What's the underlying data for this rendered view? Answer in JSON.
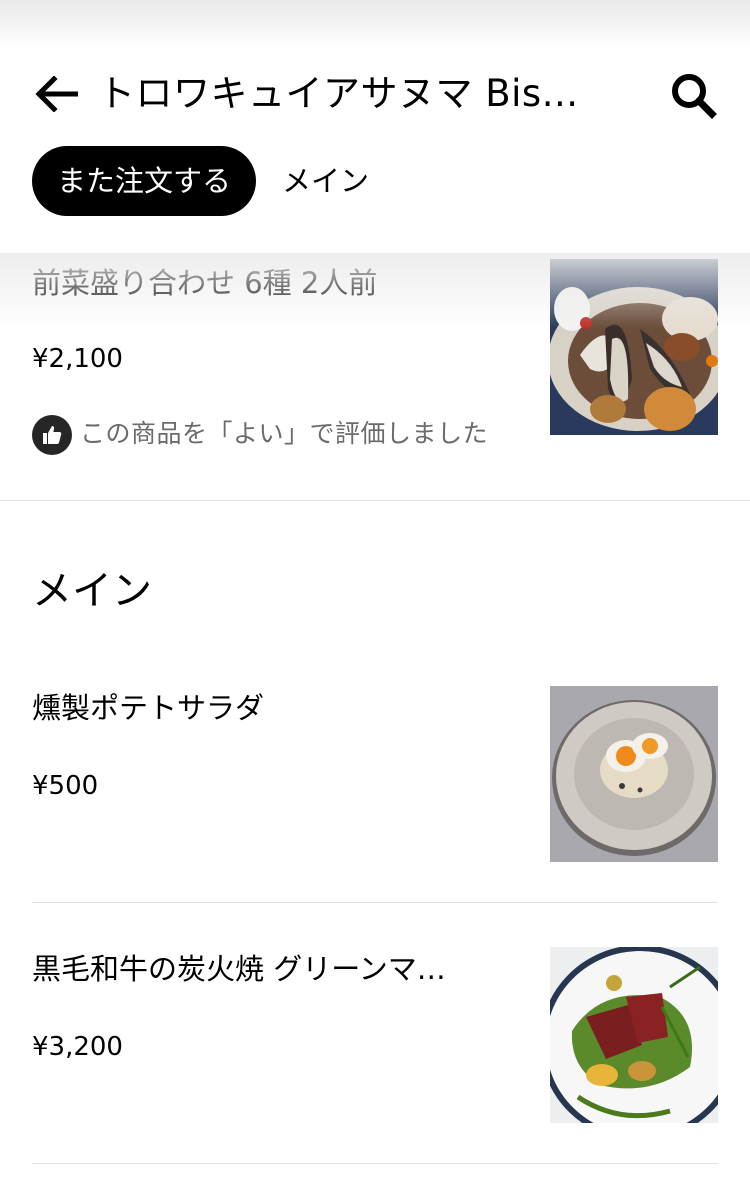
{
  "header": {
    "store_title": "トロワキュイアサヌマ Bis...",
    "tabs": [
      {
        "label": "また注文する",
        "active": true
      },
      {
        "label": "メイン",
        "active": false
      }
    ]
  },
  "reorder_section": {
    "items": [
      {
        "name": "前菜盛り合わせ 6種 2人前",
        "price": "¥2,100",
        "rating_text": "この商品を「よい」で評価しました"
      }
    ]
  },
  "main_section": {
    "title": "メイン",
    "items": [
      {
        "name": "燻製ポテトサラダ",
        "price": "¥500"
      },
      {
        "name": "黒毛和牛の炭火焼 グリーンマ…",
        "price": "¥3,200"
      }
    ]
  },
  "colors": {
    "accent": "#000000",
    "muted_text": "#6b6b6b",
    "divider": "#e2e2e2"
  }
}
